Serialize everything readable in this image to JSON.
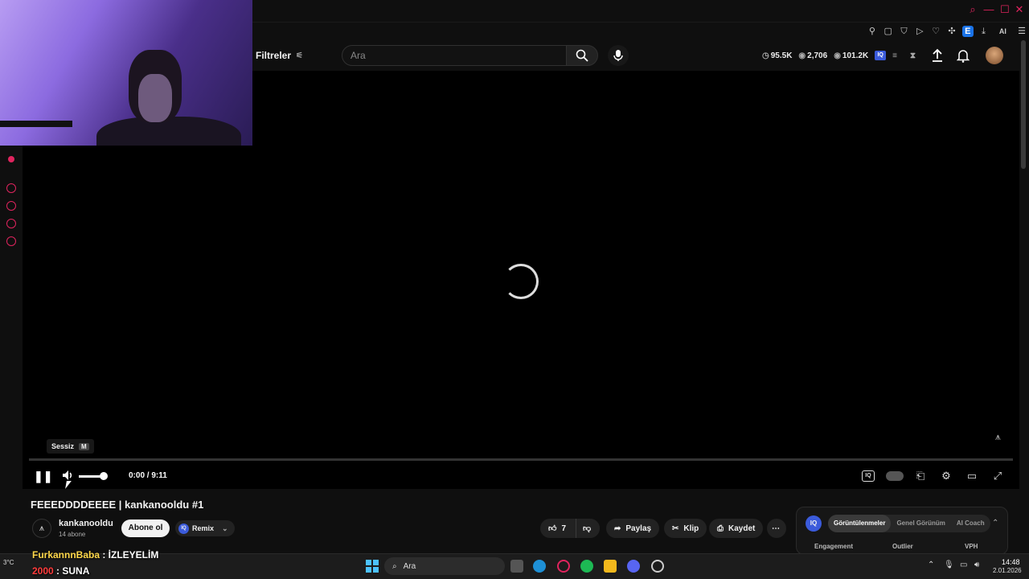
{
  "header": {
    "filters_label": "Filtreler",
    "search_placeholder": "Ara",
    "stats": [
      "95.5K",
      "2,706",
      "101.2K"
    ]
  },
  "video": {
    "tooltip_text": "Sessiz",
    "tooltip_key": "M",
    "time": "0:00 / 9:11",
    "title": "FEEEDDDDEEEE | kankanooldu #1"
  },
  "channel": {
    "name": "kankanooldu",
    "subscribers": "14 abone",
    "subscribe_label": "Abone ol",
    "remix_label": "Remix"
  },
  "actions": {
    "like_count": "7",
    "share_label": "Paylaş",
    "clip_label": "Klip",
    "save_label": "Kaydet"
  },
  "iq_panel": {
    "logo": "IQ",
    "tabs": [
      "Görüntülenmeler",
      "Genel Görünüm",
      "AI Coach"
    ],
    "columns": [
      "Engagement",
      "Outlier",
      "VPH"
    ]
  },
  "chat": [
    {
      "user": "FurkannnBaba",
      "message": " : İZLEYELİM"
    },
    {
      "user": "2000",
      "message": " : SUNA"
    }
  ],
  "taskbar": {
    "search_label": "Ara",
    "time": "14:48",
    "date": "2.01.2026",
    "weather": "3°C"
  },
  "browser": {
    "ai_label": "AI"
  },
  "colors": {
    "accent": "#e0245e",
    "iq_blue": "#3b5bdb",
    "background": "#0f0f0f"
  }
}
